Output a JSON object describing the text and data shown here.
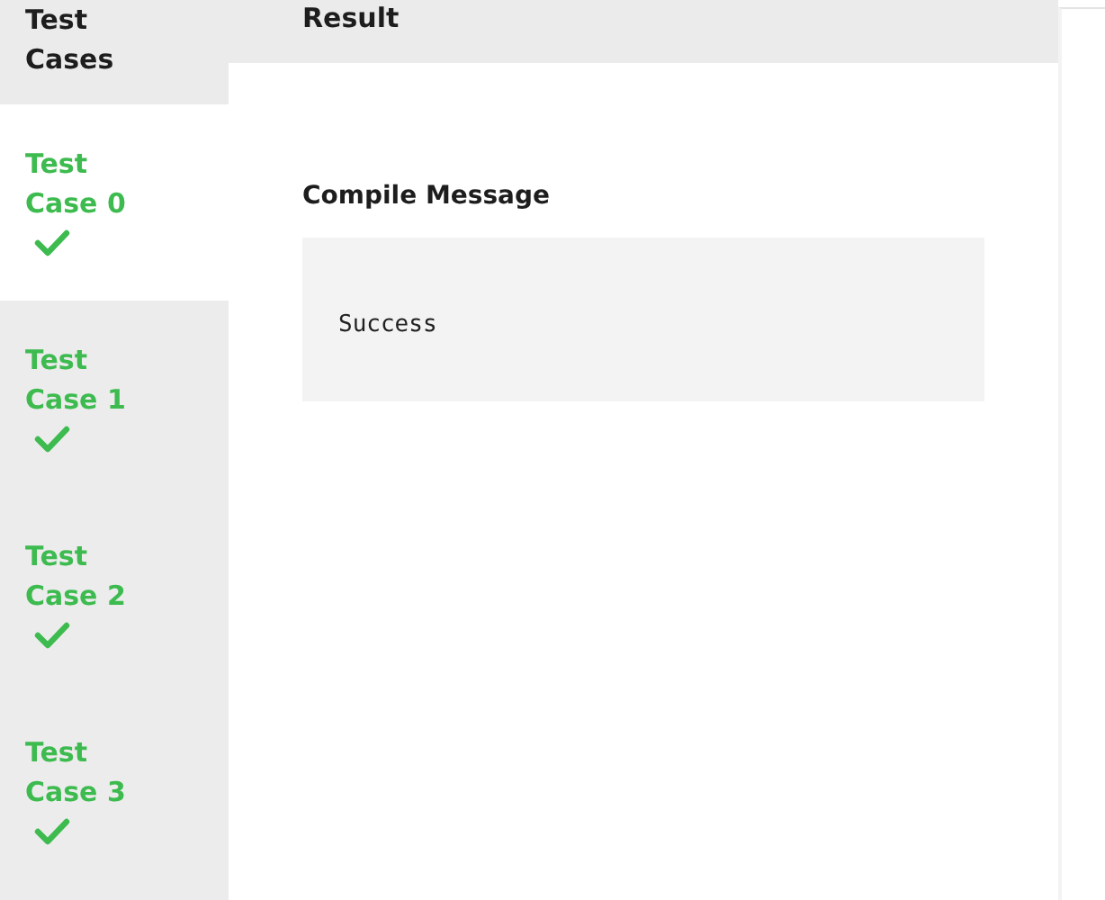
{
  "sidebar": {
    "title": "Test Cases",
    "items": [
      {
        "label": "Test Case 0",
        "selected": true,
        "passed": true
      },
      {
        "label": "Test Case 1",
        "selected": false,
        "passed": true
      },
      {
        "label": "Test Case 2",
        "selected": false,
        "passed": true
      },
      {
        "label": "Test Case 3",
        "selected": false,
        "passed": true
      }
    ]
  },
  "result": {
    "title": "Result",
    "compile_message": {
      "label": "Compile Message",
      "text": "Success"
    }
  }
}
